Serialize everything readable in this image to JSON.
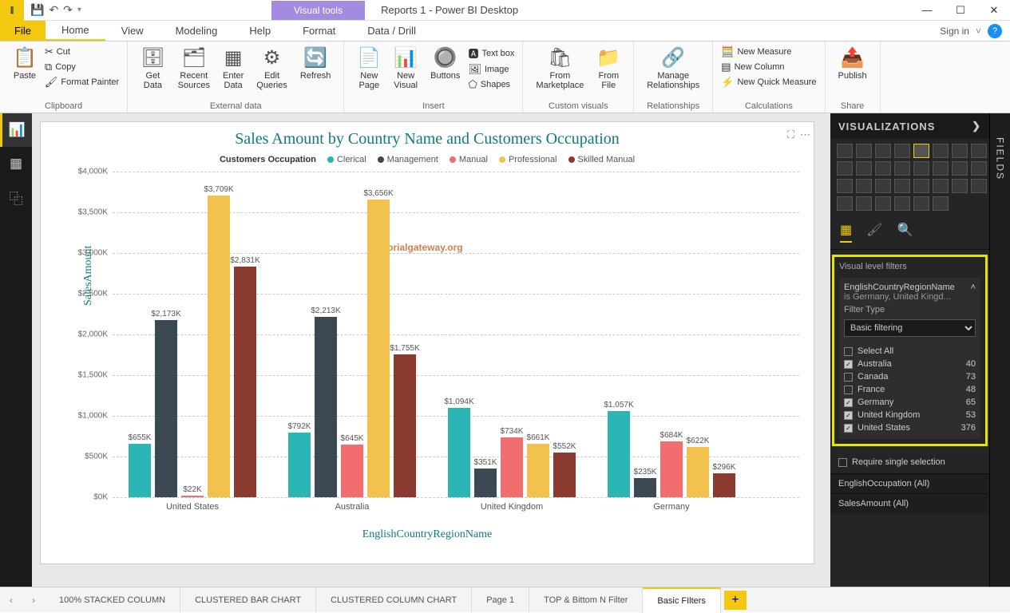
{
  "title": "Reports 1 - Power BI Desktop",
  "visualtools": "Visual tools",
  "signin": "Sign in",
  "menu": {
    "file": "File",
    "home": "Home",
    "view": "View",
    "modeling": "Modeling",
    "help": "Help",
    "format": "Format",
    "datadrill": "Data / Drill"
  },
  "ribbon": {
    "clipboard": {
      "paste": "Paste",
      "cut": "Cut",
      "copy": "Copy",
      "fmt": "Format Painter",
      "label": "Clipboard"
    },
    "ext": {
      "get": "Get\nData",
      "recent": "Recent\nSources",
      "enter": "Enter\nData",
      "edit": "Edit\nQueries",
      "refresh": "Refresh",
      "label": "External data"
    },
    "insert": {
      "page": "New\nPage",
      "visual": "New\nVisual",
      "buttons": "Buttons",
      "textbox": "Text box",
      "image": "Image",
      "shapes": "Shapes",
      "label": "Insert"
    },
    "custom": {
      "market": "From\nMarketplace",
      "file": "From\nFile",
      "label": "Custom visuals"
    },
    "rel": {
      "manage": "Manage\nRelationships",
      "label": "Relationships"
    },
    "calc": {
      "meas": "New Measure",
      "col": "New Column",
      "quick": "New Quick Measure",
      "label": "Calculations"
    },
    "share": {
      "pub": "Publish",
      "label": "Share"
    }
  },
  "chart": {
    "title": "Sales Amount by Country Name and Customers Occupation",
    "legend_title": "Customers Occupation",
    "ylabel": "SalesAmount",
    "xlabel": "EnglishCountryRegionName",
    "watermark": "©tutorialgateway.org"
  },
  "chart_data": {
    "type": "bar",
    "title": "Sales Amount by Country Name and Customers Occupation",
    "xlabel": "EnglishCountryRegionName",
    "ylabel": "SalesAmount",
    "ylim": [
      0,
      4000
    ],
    "yticks": [
      0,
      500,
      1000,
      1500,
      2000,
      2500,
      3000,
      3500,
      4000
    ],
    "ytick_labels": [
      "$0K",
      "$500K",
      "$1,000K",
      "$1,500K",
      "$2,000K",
      "$2,500K",
      "$3,000K",
      "$3,500K",
      "$4,000K"
    ],
    "categories": [
      "United States",
      "Australia",
      "United Kingdom",
      "Germany"
    ],
    "series": [
      {
        "name": "Clerical",
        "color": "#2cb5b5",
        "values": [
          655,
          792,
          1094,
          1057
        ],
        "labels": [
          "$655K",
          "$792K",
          "$1,094K",
          "$1,057K"
        ]
      },
      {
        "name": "Management",
        "color": "#3b4a52",
        "values": [
          2173,
          2213,
          351,
          235
        ],
        "labels": [
          "$2,173K",
          "$2,213K",
          "$351K",
          "$235K"
        ]
      },
      {
        "name": "Manual",
        "color": "#f26d6d",
        "values": [
          22,
          645,
          734,
          684
        ],
        "labels": [
          "$22K",
          "$645K",
          "$734K",
          "$684K"
        ]
      },
      {
        "name": "Professional",
        "color": "#f2c14e",
        "values": [
          3709,
          3656,
          661,
          622
        ],
        "labels": [
          "$3,709K",
          "$3,656K",
          "$661K",
          "$622K"
        ]
      },
      {
        "name": "Skilled Manual",
        "color": "#8a3a2e",
        "values": [
          2831,
          1755,
          552,
          296
        ],
        "labels": [
          "$2,831K",
          "$1,755K",
          "$552K",
          "$296K"
        ]
      }
    ]
  },
  "viz_header": "VISUALIZATIONS",
  "fields_label": "FIELDS",
  "filters": {
    "section": "Visual level filters",
    "field": "EnglishCountryRegionName",
    "summary": "is Germany, United Kingd...",
    "type_label": "Filter Type",
    "type_value": "Basic filtering",
    "selectall": "Select All",
    "items": [
      {
        "name": "Australia",
        "count": 40,
        "checked": true
      },
      {
        "name": "Canada",
        "count": 73,
        "checked": false
      },
      {
        "name": "France",
        "count": 48,
        "checked": false
      },
      {
        "name": "Germany",
        "count": 65,
        "checked": true
      },
      {
        "name": "United Kingdom",
        "count": 53,
        "checked": true
      },
      {
        "name": "United States",
        "count": 376,
        "checked": true
      }
    ],
    "require_single": "Require single selection",
    "well_occ": "EnglishOccupation (All)",
    "well_sales": "SalesAmount (All)"
  },
  "pages": [
    "100% STACKED COLUMN",
    "CLUSTERED BAR CHART",
    "CLUSTERED COLUMN CHART",
    "Page 1",
    "TOP & Bittom N Filter",
    "Basic FIlters"
  ]
}
